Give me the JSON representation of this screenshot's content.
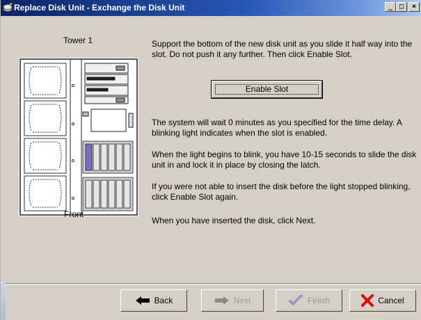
{
  "window": {
    "title": "Replace Disk Unit - Exchange the Disk Unit",
    "buttons": {
      "minimize": "_",
      "maximize": "□",
      "close": "×"
    }
  },
  "diagram": {
    "tower_label": "Tower 1",
    "view_label": "Front"
  },
  "instructions": {
    "step1": "Support the bottom of the new disk unit as you slide it half way into the slot. Do not push it any further. Then click Enable Slot.",
    "enable_slot_button": "Enable Slot",
    "wait": "The system will wait 0 minutes as you specified for the time delay. A blinking light indicates when the slot is enabled.",
    "blink": "When the light begins to blink, you have 10-15 seconds to slide the disk unit in and lock it in place by closing the latch.",
    "retry": "If you were not able to insert the disk before the light stopped blinking, click Enable Slot again.",
    "next": "When you have inserted the disk, click Next."
  },
  "nav": {
    "back": "Back",
    "next": "Next",
    "finish": "Finish",
    "cancel": "Cancel"
  },
  "colors": {
    "titlebar_start": "#0a246a",
    "titlebar_end": "#a6caf0",
    "window_bg": "#d4d0c8",
    "cancel_x": "#e00000",
    "finish_check": "#9aa0c8",
    "highlight_drive": "#7c6cc4"
  }
}
